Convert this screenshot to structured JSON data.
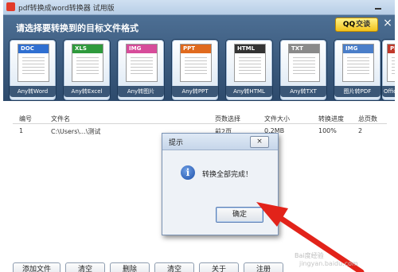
{
  "window": {
    "title": "pdf转换成word转换器 试用版"
  },
  "banner": {
    "heading": "请选择要转换到的目标文件格式",
    "qq_button": {
      "icon": "QQ",
      "label": "交谈"
    },
    "close_symbol": "×"
  },
  "formats": [
    {
      "band": "DOC",
      "band_color": "#2f6fd1",
      "label": "Any转Word"
    },
    {
      "band": "XLS",
      "band_color": "#2e9a3c",
      "label": "Any转Excel"
    },
    {
      "band": "IMG",
      "band_color": "#d74c9a",
      "label": "Any转图片"
    },
    {
      "band": "PPT",
      "band_color": "#e06a1e",
      "label": "Any转PPT"
    },
    {
      "band": "HTML",
      "band_color": "#333333",
      "label": "Any转HTML"
    },
    {
      "band": "TXT",
      "band_color": "#8a8a8a",
      "label": "Any转TXT"
    },
    {
      "band": "IMG",
      "band_color": "#4a7ec9",
      "label": "图片转PDF"
    },
    {
      "band": "PDF",
      "band_color": "#c0392b",
      "label": "Office"
    }
  ],
  "table": {
    "headers": [
      "编号",
      "文件名",
      "页数选择",
      "文件大小",
      "转换进度",
      "总页数"
    ],
    "row": [
      "1",
      "C:\\Users\\...\\测试",
      "前2页",
      "0.2MB",
      "100%",
      "2"
    ]
  },
  "dialog": {
    "title": "提示",
    "close_symbol": "×",
    "info_glyph": "i",
    "message": "转换全部完成！",
    "ok_label": "确定"
  },
  "buttons": [
    "添加文件",
    "清空",
    "删除",
    "清空",
    "关于",
    "注册"
  ],
  "watermark": {
    "line1": "Bai度经验",
    "line2": "jingyan.baidu.com"
  },
  "colors": {
    "arrow": "#e2231a",
    "banner": "#3a5a7d"
  }
}
